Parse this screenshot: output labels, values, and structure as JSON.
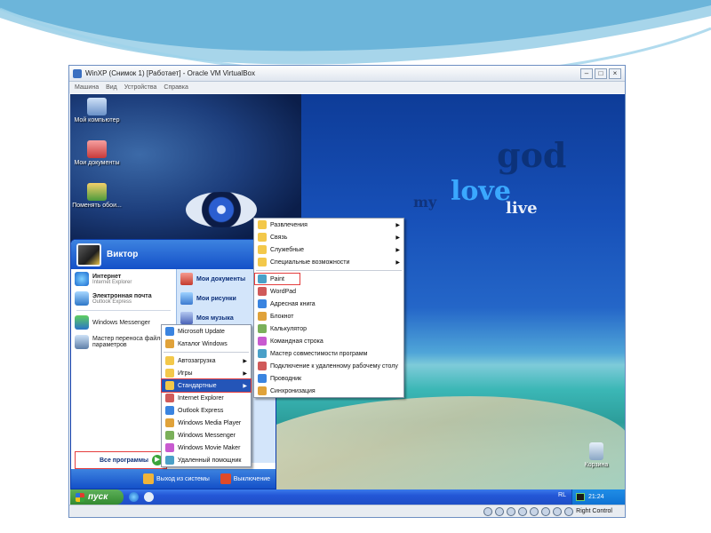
{
  "window": {
    "title": "WinXP (Снимок 1) [Работает] - Oracle VM VirtualBox",
    "menu": [
      "Машина",
      "Вид",
      "Устройства",
      "Справка"
    ],
    "status_host_key": "Right Control"
  },
  "wallpaper": {
    "words": [
      "god",
      "love",
      "my",
      "live"
    ]
  },
  "desktop_icons": [
    {
      "label": "Мой компьютер"
    },
    {
      "label": "Мои документы"
    },
    {
      "label": "Поменять обои..."
    },
    {
      "label": "Корзина"
    }
  ],
  "start_menu": {
    "user": "Виктор",
    "pinned": [
      {
        "title": "Интернет",
        "subtitle": "Internet Explorer"
      },
      {
        "title": "Электронная почта",
        "subtitle": "Outlook Express"
      }
    ],
    "recent": [
      {
        "title": "Windows Messenger"
      },
      {
        "title": "Мастер переноса файлов и параметров"
      }
    ],
    "right": [
      "Мои документы",
      "Мои рисунки",
      "Моя музыка"
    ],
    "all_programs": "Все программы",
    "logoff": "Выход из системы",
    "shutdown": "Выключение"
  },
  "programs_menu": [
    {
      "label": "Microsoft Update"
    },
    {
      "label": "Каталог Windows"
    },
    {
      "label": "Автозагрузка",
      "sub": true
    },
    {
      "label": "Игры",
      "sub": true
    },
    {
      "label": "Стандартные",
      "sub": true
    },
    {
      "label": "Internet Explorer"
    },
    {
      "label": "Outlook Express"
    },
    {
      "label": "Windows Media Player"
    },
    {
      "label": "Windows Messenger"
    },
    {
      "label": "Windows Movie Maker"
    },
    {
      "label": "Удаленный помощник"
    }
  ],
  "accessories_menu": [
    {
      "label": "Развлечения",
      "sub": true
    },
    {
      "label": "Связь",
      "sub": true
    },
    {
      "label": "Служебные",
      "sub": true
    },
    {
      "label": "Специальные возможности",
      "sub": true
    },
    {
      "label": "Paint"
    },
    {
      "label": "WordPad"
    },
    {
      "label": "Адресная книга"
    },
    {
      "label": "Блокнот"
    },
    {
      "label": "Калькулятор"
    },
    {
      "label": "Командная строка"
    },
    {
      "label": "Мастер совместимости программ"
    },
    {
      "label": "Подключение к удаленному рабочему столу"
    },
    {
      "label": "Проводник"
    },
    {
      "label": "Синхронизация"
    }
  ],
  "taskbar": {
    "start": "пуск",
    "language": "RL",
    "clock": "21:24"
  },
  "colors": {
    "xp_blue": "#1f4fc7",
    "highlight": "#2455b8",
    "red_box": "#e43d3d",
    "start_green": "#338a2f"
  }
}
